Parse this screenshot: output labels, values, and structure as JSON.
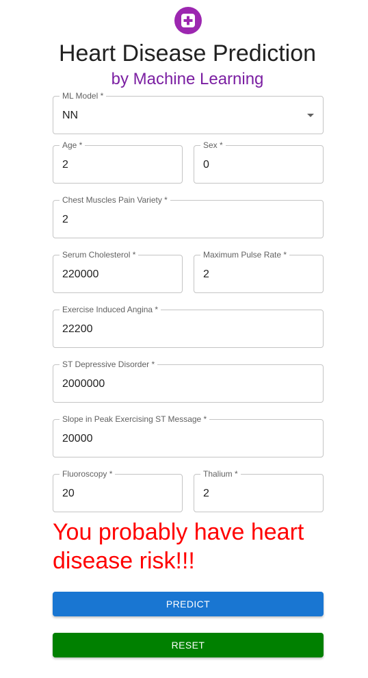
{
  "header": {
    "title": "Heart Disease Prediction",
    "subtitle": "by Machine Learning",
    "logo_icon": "medical-plus-icon",
    "logo_color": "#9c27b0"
  },
  "form": {
    "model": {
      "label": "ML Model *",
      "value": "NN"
    },
    "age": {
      "label": "Age *",
      "value": "2"
    },
    "sex": {
      "label": "Sex *",
      "value": "0"
    },
    "chest_pain": {
      "label": "Chest Muscles Pain Variety *",
      "value": "2"
    },
    "cholesterol": {
      "label": "Serum Cholesterol *",
      "value": "220000"
    },
    "max_pulse": {
      "label": "Maximum Pulse Rate *",
      "value": "2"
    },
    "angina": {
      "label": "Exercise Induced Angina *",
      "value": "22200"
    },
    "st_depression": {
      "label": "ST Depressive Disorder *",
      "value": "2000000"
    },
    "slope": {
      "label": "Slope in Peak Exercising ST Message *",
      "value": "20000"
    },
    "fluoroscopy": {
      "label": "Fluoroscopy *",
      "value": "20"
    },
    "thalium": {
      "label": "Thalium *",
      "value": "2"
    }
  },
  "result": {
    "text": "You probably have heart disease risk!!!",
    "color": "#ff0000"
  },
  "buttons": {
    "predict_label": "Predict",
    "reset_label": "Reset",
    "predict_color": "#1976d2",
    "reset_color": "#008000"
  }
}
